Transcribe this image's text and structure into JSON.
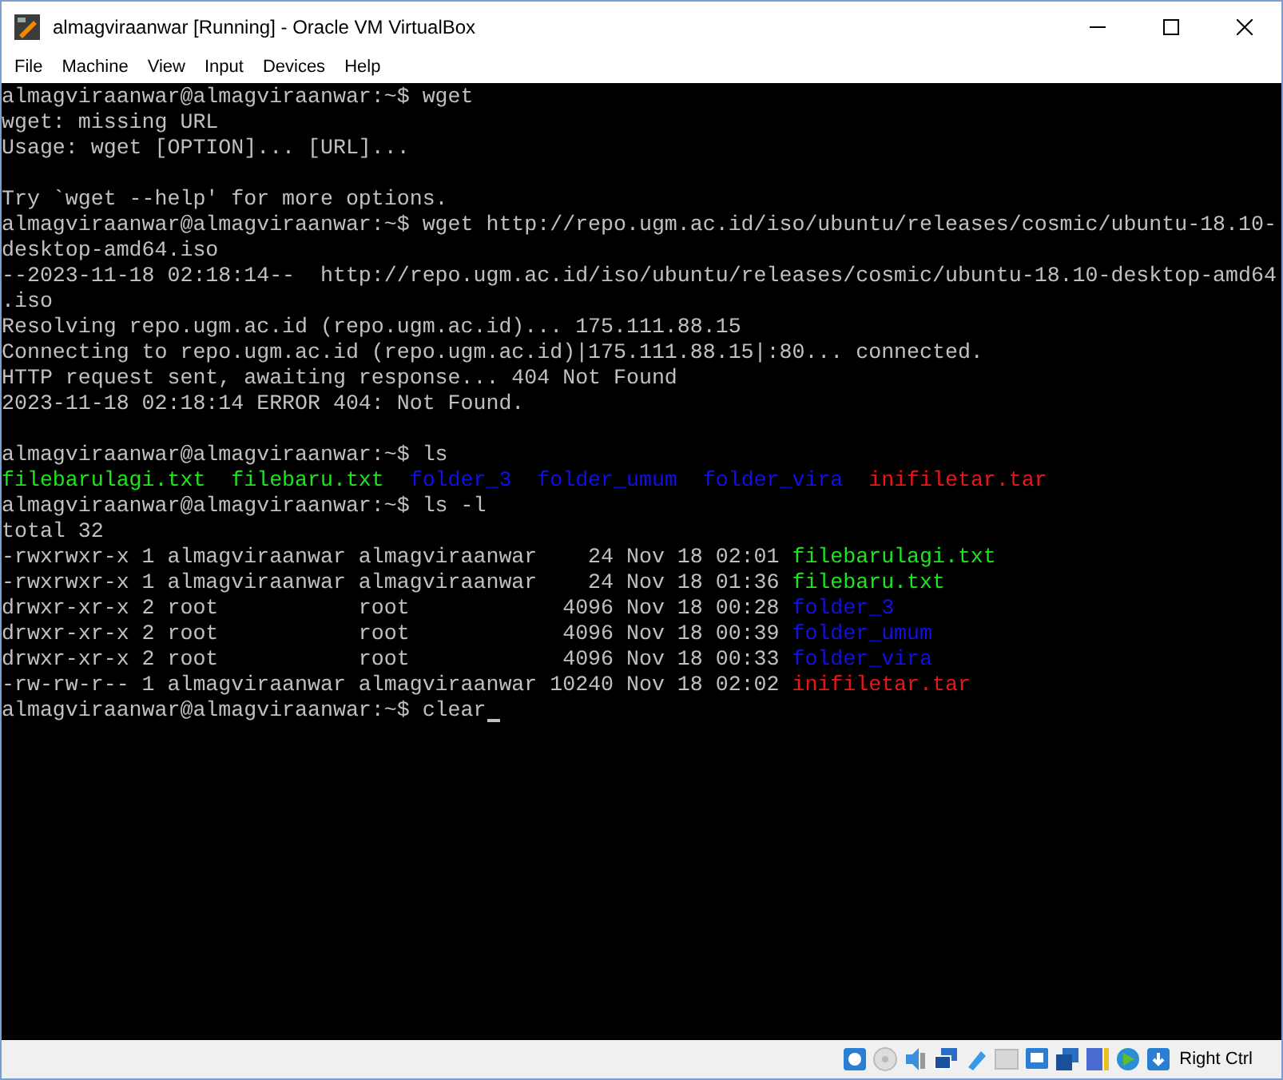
{
  "window": {
    "title": "almagviraanwar [Running] - Oracle VM VirtualBox"
  },
  "menu": [
    "File",
    "Machine",
    "View",
    "Input",
    "Devices",
    "Help"
  ],
  "terminal": {
    "cursor_visible": true,
    "lines": [
      {
        "kind": "text",
        "segments": [
          {
            "text": "almagviraanwar@almagviraanwar:~$ wget",
            "color": "#c0c0c0"
          }
        ]
      },
      {
        "kind": "text",
        "segments": [
          {
            "text": "wget: missing URL",
            "color": "#c0c0c0"
          }
        ]
      },
      {
        "kind": "text",
        "segments": [
          {
            "text": "Usage: wget [OPTION]... [URL]...",
            "color": "#c0c0c0"
          }
        ]
      },
      {
        "kind": "blank"
      },
      {
        "kind": "text",
        "segments": [
          {
            "text": "Try `wget --help' for more options.",
            "color": "#c0c0c0"
          }
        ]
      },
      {
        "kind": "text",
        "segments": [
          {
            "text": "almagviraanwar@almagviraanwar:~$ wget http://repo.ugm.ac.id/iso/ubuntu/releases/cosmic/ubuntu-18.10-",
            "color": "#c0c0c0"
          }
        ]
      },
      {
        "kind": "text",
        "segments": [
          {
            "text": "desktop-amd64.iso",
            "color": "#c0c0c0"
          }
        ]
      },
      {
        "kind": "text",
        "segments": [
          {
            "text": "--2023-11-18 02:18:14--  http://repo.ugm.ac.id/iso/ubuntu/releases/cosmic/ubuntu-18.10-desktop-amd64",
            "color": "#c0c0c0"
          }
        ]
      },
      {
        "kind": "text",
        "segments": [
          {
            "text": ".iso",
            "color": "#c0c0c0"
          }
        ]
      },
      {
        "kind": "text",
        "segments": [
          {
            "text": "Resolving repo.ugm.ac.id (repo.ugm.ac.id)... 175.111.88.15",
            "color": "#c0c0c0"
          }
        ]
      },
      {
        "kind": "text",
        "segments": [
          {
            "text": "Connecting to repo.ugm.ac.id (repo.ugm.ac.id)|175.111.88.15|:80... connected.",
            "color": "#c0c0c0"
          }
        ]
      },
      {
        "kind": "text",
        "segments": [
          {
            "text": "HTTP request sent, awaiting response... 404 Not Found",
            "color": "#c0c0c0"
          }
        ]
      },
      {
        "kind": "text",
        "segments": [
          {
            "text": "2023-11-18 02:18:14 ERROR 404: Not Found.",
            "color": "#c0c0c0"
          }
        ]
      },
      {
        "kind": "blank"
      },
      {
        "kind": "text",
        "segments": [
          {
            "text": "almagviraanwar@almagviraanwar:~$ ls",
            "color": "#c0c0c0"
          }
        ]
      },
      {
        "kind": "listing",
        "segments": [
          {
            "text": "filebarulagi.txt",
            "color": "#1ee61e"
          },
          {
            "text": "filebaru.txt",
            "color": "#1ee61e"
          },
          {
            "text": "folder_3",
            "color": "#1010e8"
          },
          {
            "text": "folder_umum",
            "color": "#1010e8"
          },
          {
            "text": "folder_vira",
            "color": "#1010e8"
          },
          {
            "text": "inifiletar.tar",
            "color": "#f01414"
          }
        ]
      },
      {
        "kind": "text",
        "segments": [
          {
            "text": "almagviraanwar@almagviraanwar:~$ ls -l",
            "color": "#c0c0c0"
          }
        ]
      },
      {
        "kind": "text",
        "segments": [
          {
            "text": "total 32",
            "color": "#c0c0c0"
          }
        ]
      },
      {
        "kind": "text",
        "segments": [
          {
            "text": "-rwxrwxr-x 1 almagviraanwar almagviraanwar    24 Nov 18 02:01",
            "color": "#c0c0c0"
          },
          {
            "text": "filebarulagi.txt",
            "color": "#1ee61e"
          }
        ]
      },
      {
        "kind": "text",
        "segments": [
          {
            "text": "-rwxrwxr-x 1 almagviraanwar almagviraanwar    24 Nov 18 01:36",
            "color": "#c0c0c0"
          },
          {
            "text": "filebaru.txt",
            "color": "#1ee61e"
          }
        ]
      },
      {
        "kind": "text",
        "segments": [
          {
            "text": "drwxr-xr-x 2 root           root            4096 Nov 18 00:28",
            "color": "#c0c0c0"
          },
          {
            "text": "folder_3",
            "color": "#1010e8"
          }
        ]
      },
      {
        "kind": "text",
        "segments": [
          {
            "text": "drwxr-xr-x 2 root           root            4096 Nov 18 00:39",
            "color": "#c0c0c0"
          },
          {
            "text": "folder_umum",
            "color": "#1010e8"
          }
        ]
      },
      {
        "kind": "text",
        "segments": [
          {
            "text": "drwxr-xr-x 2 root           root            4096 Nov 18 00:33",
            "color": "#c0c0c0"
          },
          {
            "text": "folder_vira",
            "color": "#1010e8"
          }
        ]
      },
      {
        "kind": "text",
        "segments": [
          {
            "text": "-rw-rw-r-- 1 almagviraanwar almagviraanwar 10240 Nov 18 02:02",
            "color": "#c0c0c0"
          },
          {
            "text": "inifiletar.tar",
            "color": "#f01414"
          }
        ]
      },
      {
        "kind": "text",
        "segments": [
          {
            "text": "almagviraanwar@almagviraanwar:~$ clear",
            "color": "#c0c0c0"
          }
        ]
      }
    ]
  },
  "status_bar": {
    "host_key": "Right Ctrl"
  }
}
